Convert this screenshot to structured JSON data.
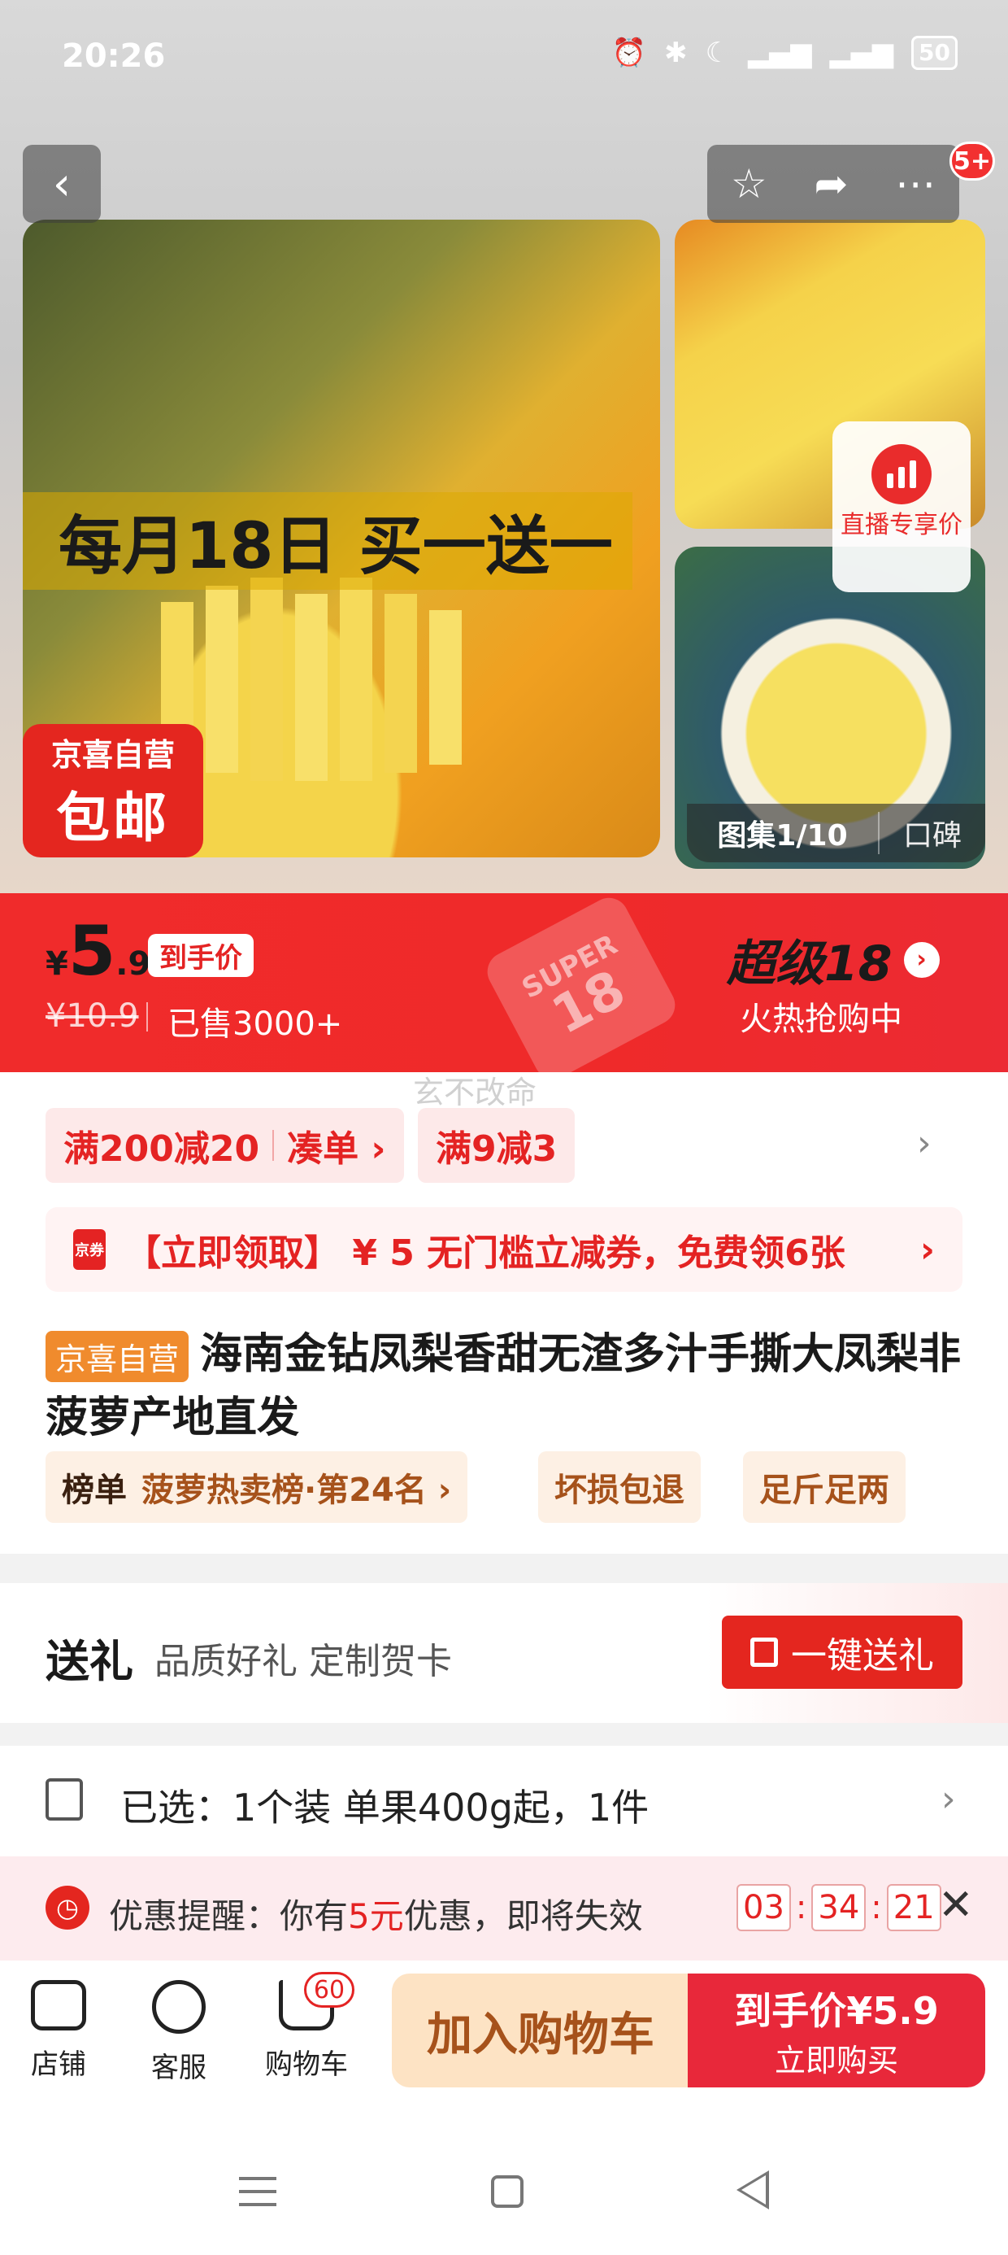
{
  "status_bar": {
    "time": "20:26",
    "icons": [
      "alarm-icon",
      "bluetooth-icon",
      "moon-icon",
      "5g-signal-icon",
      "5g-signal-icon"
    ],
    "battery": "50"
  },
  "header": {
    "more_badge": "5+",
    "action_icons": [
      "star-icon",
      "share-icon",
      "more-icon"
    ]
  },
  "gallery": {
    "promo_text": "每月18日 买一送一",
    "badge_line1": "京喜自营",
    "badge_line2": "包邮",
    "live_label": "直播专享价",
    "count_label": "图集1/10",
    "tab_label": "口碑"
  },
  "price": {
    "currency": "¥",
    "integer": "5",
    "decimal": ".9",
    "tag": "到手价",
    "original": "¥10.9",
    "sold": "已售3000+",
    "super_tag_a": "SUPER",
    "super_tag_b": "18",
    "super_title": "超级18",
    "super_sub": "火热抢购中",
    "accent": "#f02b2b"
  },
  "watermark": "玄不改命",
  "promos": {
    "pill1_text": "满200减20",
    "pill1_link": "凑单 ›",
    "pill2_text": "满9减3",
    "coupon_icon": "京券",
    "coupon_text": "【立即领取】 ¥ 5 无门槛立减券，免费领6张"
  },
  "product": {
    "badge": "京喜自营",
    "title": "海南金钻凤梨香甜无渣多汁手撕大凤梨非菠萝产地直发",
    "rank_key": "榜单",
    "rank_value": "菠萝热卖榜·第24名 ›",
    "tag_return": "坏损包退",
    "tag_weight": "足斤足两"
  },
  "gift": {
    "title": "送礼",
    "subtitle": "品质好礼 定制贺卡",
    "button": "一键送礼"
  },
  "selected": {
    "text": "已选：1个装 单果400g起，1件"
  },
  "reminder": {
    "prefix": "优惠提醒：你有",
    "amount": "5元",
    "suffix": "优惠，即将失效",
    "h": "03",
    "m": "34",
    "s": "21"
  },
  "bottom": {
    "shop": "店铺",
    "service": "客服",
    "cart": "购物车",
    "cart_badge": "60",
    "add_cart": "加入购物车",
    "buy_price": "到手价¥5.9",
    "buy_now": "立即购买"
  }
}
